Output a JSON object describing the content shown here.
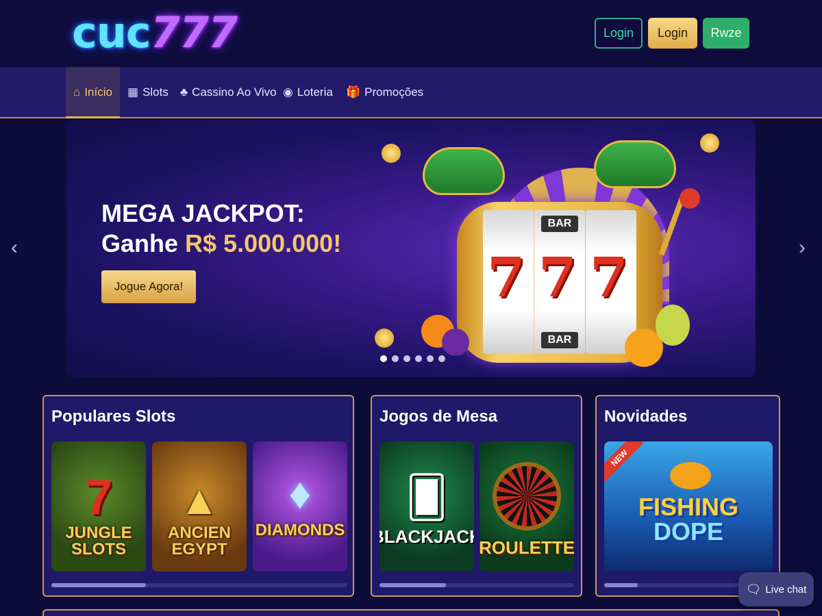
{
  "header": {
    "logo_main": "cuc",
    "logo_number": "777",
    "login_outline_label": "Login",
    "login_gold_label": "Login",
    "register_label": "Rwze"
  },
  "nav": {
    "items": [
      {
        "label": "Início",
        "icon": "home-icon",
        "active": true
      },
      {
        "label": "Slots",
        "icon": "slot-grid-icon",
        "active": false
      },
      {
        "label": "Cassino Ao Vivo",
        "icon": "card-suit-icon",
        "active": false
      },
      {
        "label": "Loteria",
        "icon": "lottery-ball-icon",
        "active": false
      },
      {
        "label": "Promoções",
        "icon": "gift-icon",
        "active": false
      }
    ]
  },
  "banner": {
    "title_line1": "MEGA JACKPOT:",
    "title_line2_prefix": "Ganhe ",
    "title_line2_amount": "R$ 5.000.000!",
    "cta_label": "Jogue Agora!",
    "reel_symbol": "7",
    "bar_label": "BAR",
    "slides_total": 6,
    "active_slide": 1,
    "prev_arrow": "‹",
    "next_arrow": "›"
  },
  "sections": [
    {
      "title": "Populares Slots",
      "games": [
        {
          "line1": "JUNGLE",
          "line2": "SLOTS"
        },
        {
          "line1": "ANCIEN",
          "line2": "EGYPT"
        },
        {
          "line1": "DIAMONDS",
          "line2": ""
        }
      ],
      "scroll_fraction": 0.32
    },
    {
      "title": "Jogos de Mesa",
      "games": [
        {
          "line1": "BLACKJACK",
          "line2": ""
        },
        {
          "line1": "ROULETTE",
          "line2": ""
        }
      ],
      "scroll_fraction": 0.34
    },
    {
      "title": "Novidades",
      "games": [
        {
          "line1": "FISHING",
          "line2": "DOPE",
          "badge": "NEW"
        }
      ],
      "scroll_fraction": 0.2
    }
  ],
  "live_chat": {
    "label": "Live chat",
    "icon": "chat-bubble-icon"
  },
  "colors": {
    "background": "#0d0b3a",
    "nav": "#241a6a",
    "gold": "#e6b54b",
    "green": "#2eae6a"
  }
}
